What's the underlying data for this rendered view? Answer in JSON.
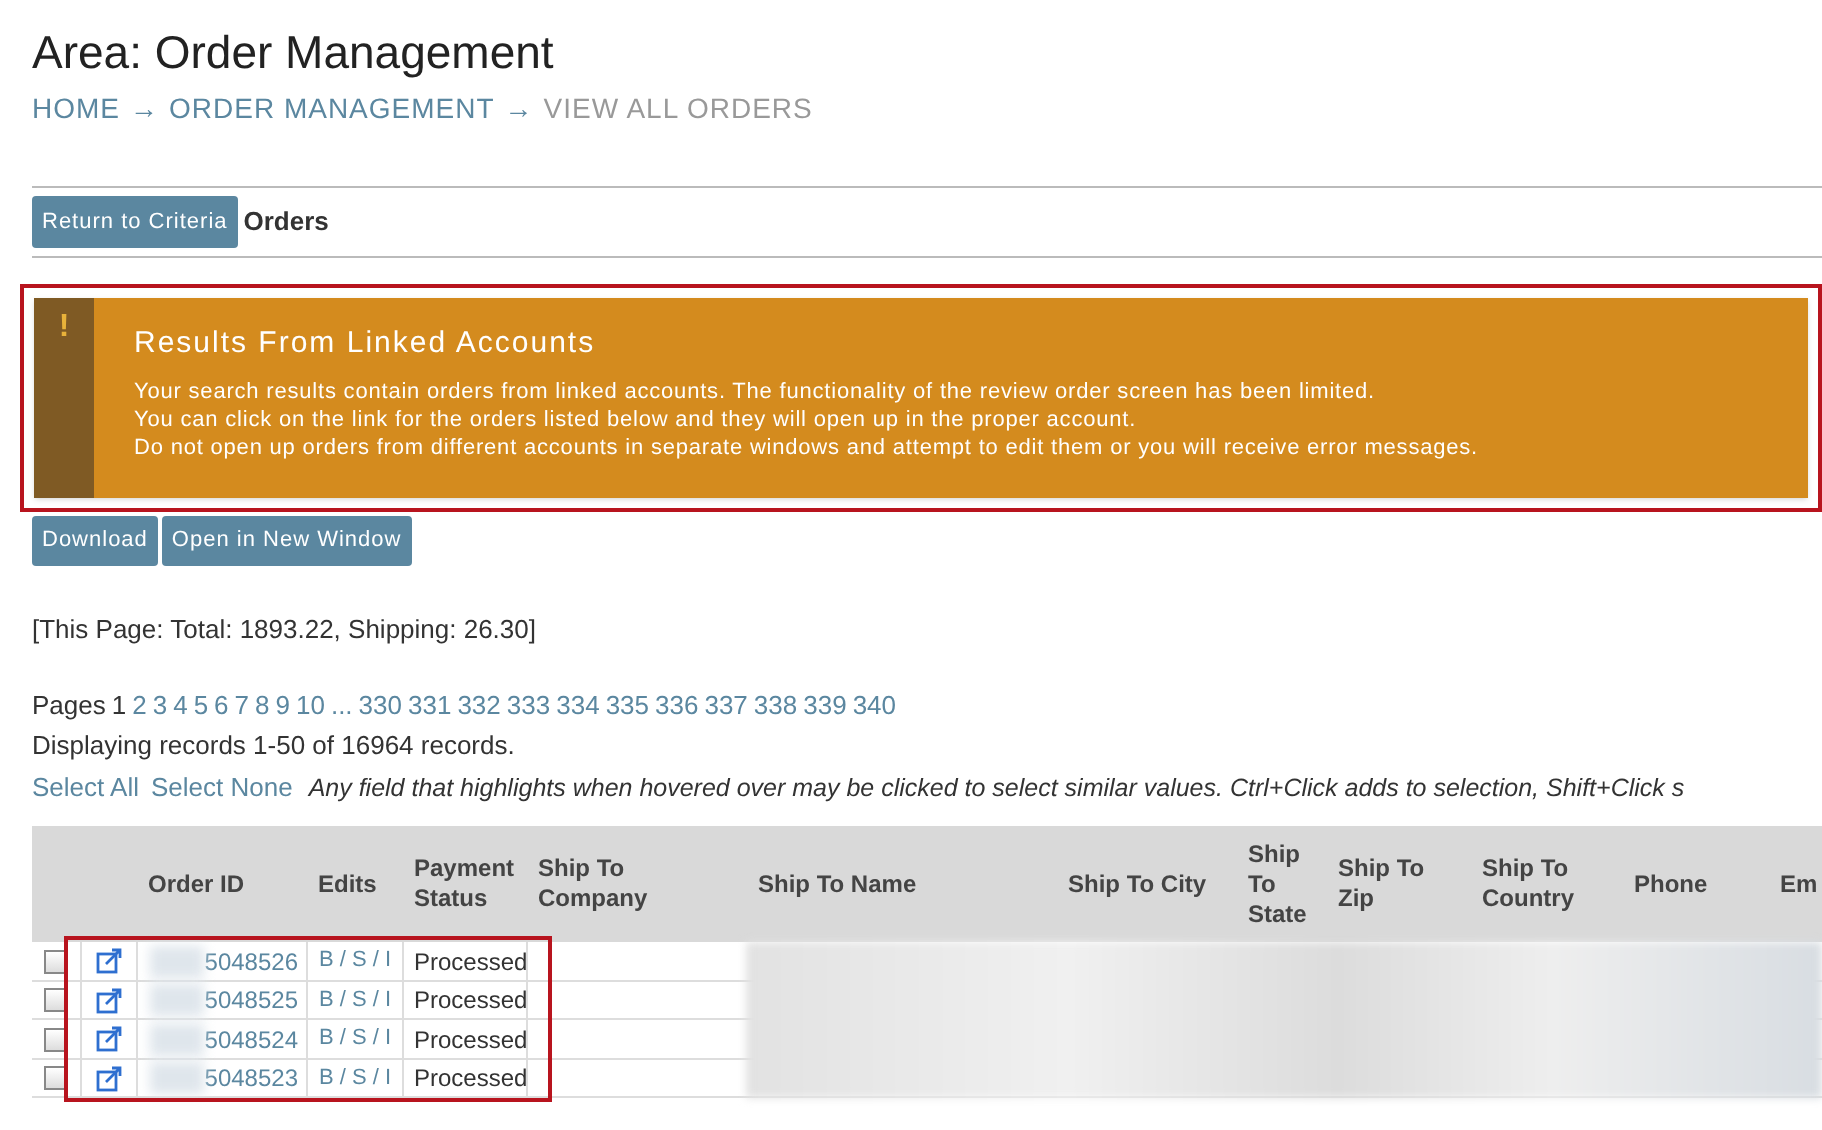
{
  "page_title": "Area: Order Management",
  "breadcrumb": [
    {
      "label": "HOME",
      "current": false
    },
    {
      "label": "ORDER MANAGEMENT",
      "current": false
    },
    {
      "label": "VIEW ALL ORDERS",
      "current": true
    }
  ],
  "breadcrumb_separator": "→",
  "toolbar": {
    "button": "Return to Criteria",
    "heading": "Orders"
  },
  "alert": {
    "icon": "!",
    "title": "Results From Linked Accounts",
    "lines": [
      "Your search results contain orders from linked accounts. The functionality of the review order screen has been limited.",
      "You can click on the link for the orders listed below and they will open up in the proper account.",
      "Do not open up orders from different accounts in separate windows and attempt to edit them or you will receive error messages."
    ]
  },
  "action_buttons": [
    "Download",
    "Open in New Window"
  ],
  "page_totals": "[This Page: Total: 1893.22, Shipping: 26.30]",
  "pagination": {
    "label": "Pages",
    "pages": [
      {
        "label": "1",
        "selected": true
      },
      {
        "label": "2",
        "selected": false
      },
      {
        "label": "3",
        "selected": false
      },
      {
        "label": "4",
        "selected": false
      },
      {
        "label": "5",
        "selected": false
      },
      {
        "label": "6",
        "selected": false
      },
      {
        "label": "7",
        "selected": false
      },
      {
        "label": "8",
        "selected": false
      },
      {
        "label": "9",
        "selected": false
      },
      {
        "label": "10",
        "selected": false
      },
      {
        "label": "...",
        "selected": false
      },
      {
        "label": "330",
        "selected": false
      },
      {
        "label": "331",
        "selected": false
      },
      {
        "label": "332",
        "selected": false
      },
      {
        "label": "333",
        "selected": false
      },
      {
        "label": "334",
        "selected": false
      },
      {
        "label": "335",
        "selected": false
      },
      {
        "label": "336",
        "selected": false
      },
      {
        "label": "337",
        "selected": false
      },
      {
        "label": "338",
        "selected": false
      },
      {
        "label": "339",
        "selected": false
      },
      {
        "label": "340",
        "selected": false
      }
    ]
  },
  "record_count": "Displaying records 1-50 of 16964 records.",
  "selection_links": [
    "Select All",
    "Select None"
  ],
  "hint": "Any field that highlights when hovered over may be clicked to select similar values. Ctrl+Click adds to selection, Shift+Click s",
  "table": {
    "columns": [
      "Order ID",
      "Edits",
      "Payment Status",
      "Ship To Company",
      "Ship To Name",
      "Ship To City",
      "Ship To State",
      "Ship To Zip",
      "Ship To Country",
      "Phone",
      "Em"
    ],
    "rows": [
      {
        "checked": false,
        "order_id": "5048526",
        "edits": "B / S / I",
        "payment_status": "Processed"
      },
      {
        "checked": false,
        "order_id": "5048525",
        "edits": "B / S / I",
        "payment_status": "Processed"
      },
      {
        "checked": false,
        "order_id": "5048524",
        "edits": "B / S / I",
        "payment_status": "Processed"
      },
      {
        "checked": false,
        "order_id": "5048523",
        "edits": "B / S / I",
        "payment_status": "Processed"
      }
    ]
  }
}
